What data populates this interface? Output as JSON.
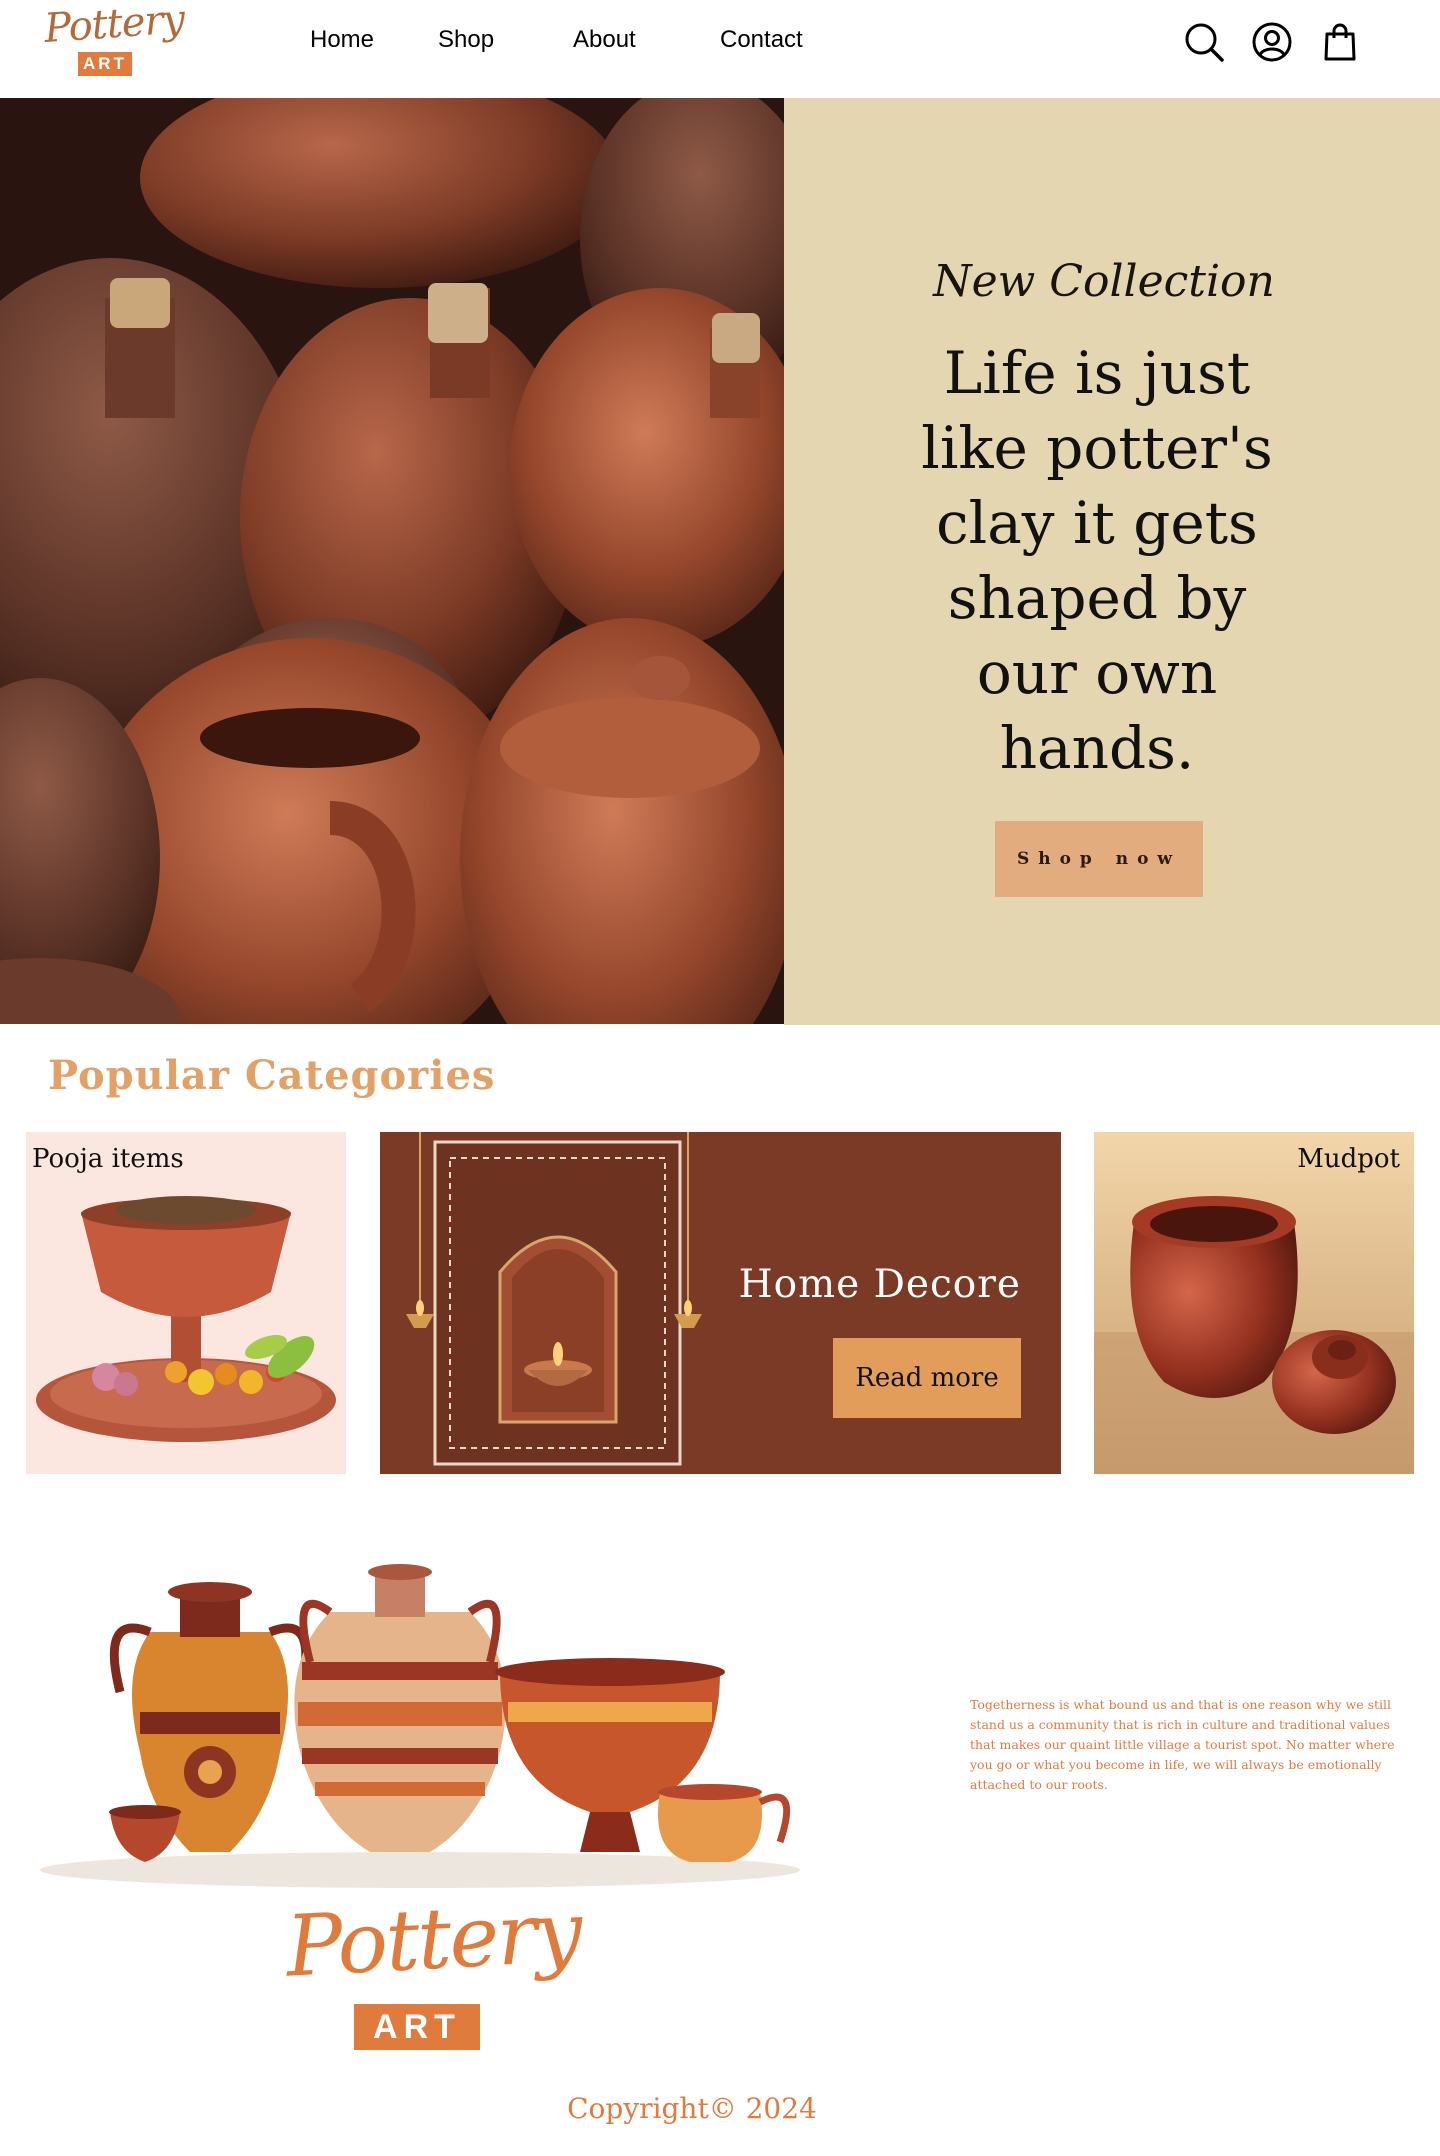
{
  "brand": {
    "logo_word": "Pottery",
    "logo_sub": "ART"
  },
  "nav": {
    "items": [
      "Home",
      "Shop",
      "About",
      "Contact"
    ]
  },
  "header_icons": [
    "search-icon",
    "account-icon",
    "shopping-bag-icon"
  ],
  "hero": {
    "kicker": "New Collection",
    "quote_lines": [
      "Life is just",
      "like potter's",
      "clay it gets",
      "shaped by",
      "our own",
      "hands."
    ],
    "button_label": "Shop now"
  },
  "categories": {
    "title": "Popular Categories",
    "pooja_label": "Pooja items",
    "decor_title": "Home Decore",
    "decor_button": "Read more",
    "mud_label": "Mudpot"
  },
  "about": {
    "logo_word": "Pottery",
    "logo_sub": "ART",
    "text": "Togetherness is what bound us and that is one reason why we still stand us a community that is rich in culture and traditional values that makes our quaint little village a tourist spot. No matter where you go or what you become in life, we will always be emotionally attached to our roots."
  },
  "footer": {
    "copyright": "Copyright© 2024"
  },
  "colors": {
    "accent": "#e07b3e",
    "hero_panel": "#e4d6b1",
    "hero_button": "#e2ac7e",
    "category_title": "#e2a167",
    "decor_bg": "#7a3a26",
    "decor_button": "#e39d5b"
  }
}
